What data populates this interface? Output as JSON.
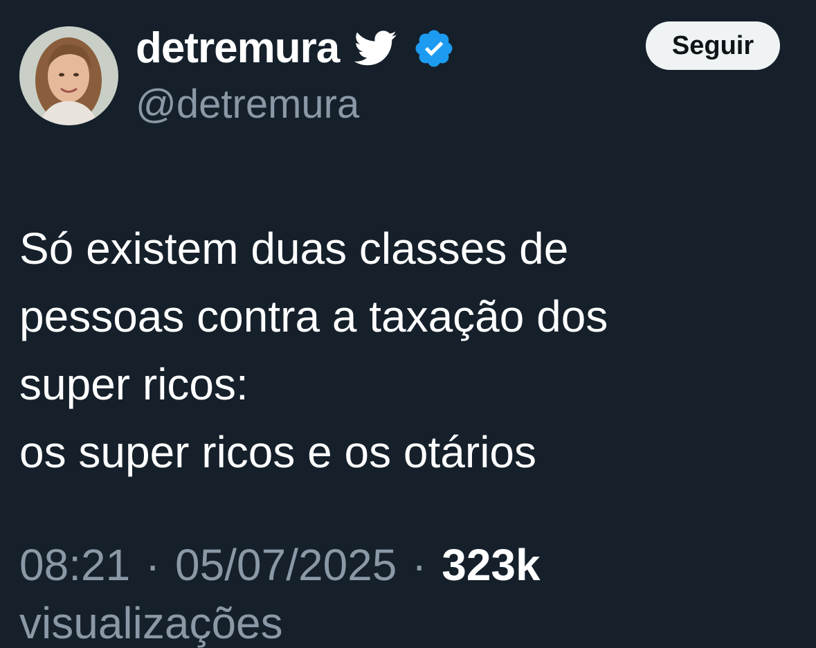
{
  "colors": {
    "background": "#15202b",
    "primary_text": "#ffffff",
    "secondary_text": "#8b98a5",
    "verified_badge": "#1d9bf0",
    "follow_button_bg": "#eff3f4",
    "follow_button_text": "#0f1419"
  },
  "author": {
    "display_name": "detremura",
    "handle": "@detremura",
    "avatar_icon": "user-avatar-photo",
    "bird_icon": "twitter-bird-icon",
    "verified_icon": "verified-badge-icon"
  },
  "follow_button": {
    "label": "Seguir"
  },
  "tweet": {
    "lines": [
      "Só existem duas classes de",
      "pessoas contra a taxação dos",
      "super ricos:",
      "os super ricos e os otários"
    ]
  },
  "meta": {
    "time": "08:21",
    "separator": "·",
    "date": "05/07/2025",
    "views_count": "323k",
    "views_label": "visualizações"
  }
}
